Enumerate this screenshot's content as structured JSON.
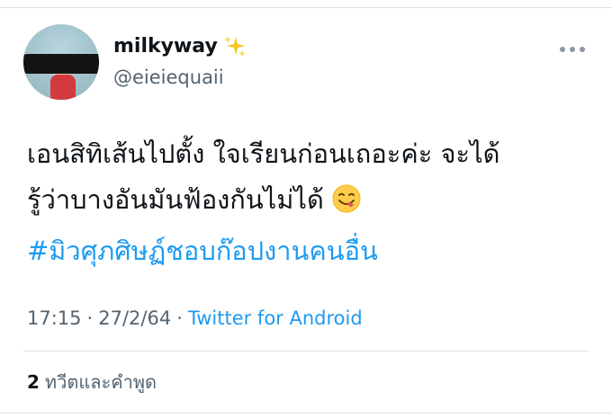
{
  "tweet": {
    "author": {
      "display_name": "milkyway",
      "name_emoji": "sparkles-icon",
      "handle": "@eieiequaii"
    },
    "more_icon": "ellipsis-icon",
    "text_lines": [
      "เอนสิทิเส้นไปตั้ง ใจเรียนก่อนเถอะค่ะ จะได้",
      "รู้ว่าบางอันมันฟ้องกันไม่ได้"
    ],
    "inline_emoji": "smiling-face-savoring-food-icon",
    "hashtag": "#มิวศุภศิษฏ์ชอบก๊อปงานคนอื่น",
    "time": "17:15",
    "date": "27/2/64",
    "separator": "·",
    "source": "Twitter for Android",
    "stats": {
      "count": "2",
      "label": "ทวีตและคำพูด"
    }
  },
  "colors": {
    "link": "#1d9bf0",
    "secondary_text": "#536471",
    "primary_text": "#0f1419",
    "divider": "#d8dde1"
  }
}
